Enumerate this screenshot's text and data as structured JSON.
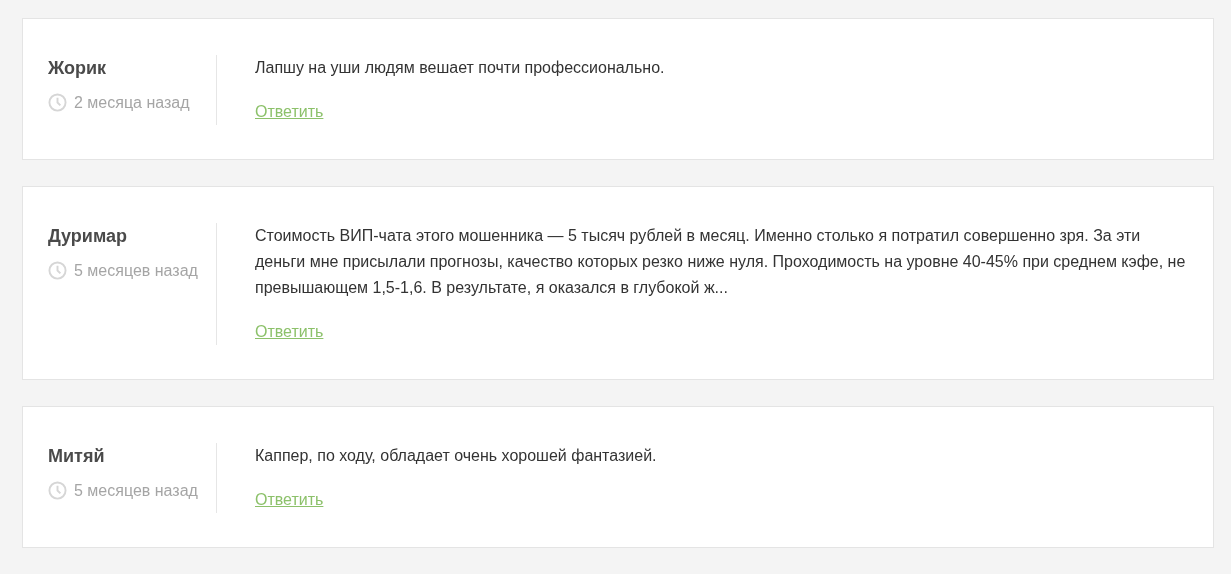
{
  "comments": [
    {
      "author": "Жорик",
      "time": "2 месяца назад",
      "text": "Лапшу на уши людям вешает почти профессионально.",
      "reply": "Ответить"
    },
    {
      "author": "Дуримар",
      "time": "5 месяцев назад",
      "text": "Стоимость ВИП-чата этого мошенника — 5 тысяч рублей в месяц. Именно столько я потратил совершенно зря. За эти деньги мне присылали прогнозы, качество которых резко ниже нуля. Проходимость на уровне 40-45% при среднем кэфе, не превышающем 1,5-1,6. В результате, я оказался в глубокой ж...",
      "reply": "Ответить"
    },
    {
      "author": "Митяй",
      "time": "5 месяцев назад",
      "text": "Каппер, по ходу, обладает очень хорошей фантазией.",
      "reply": "Ответить"
    }
  ]
}
